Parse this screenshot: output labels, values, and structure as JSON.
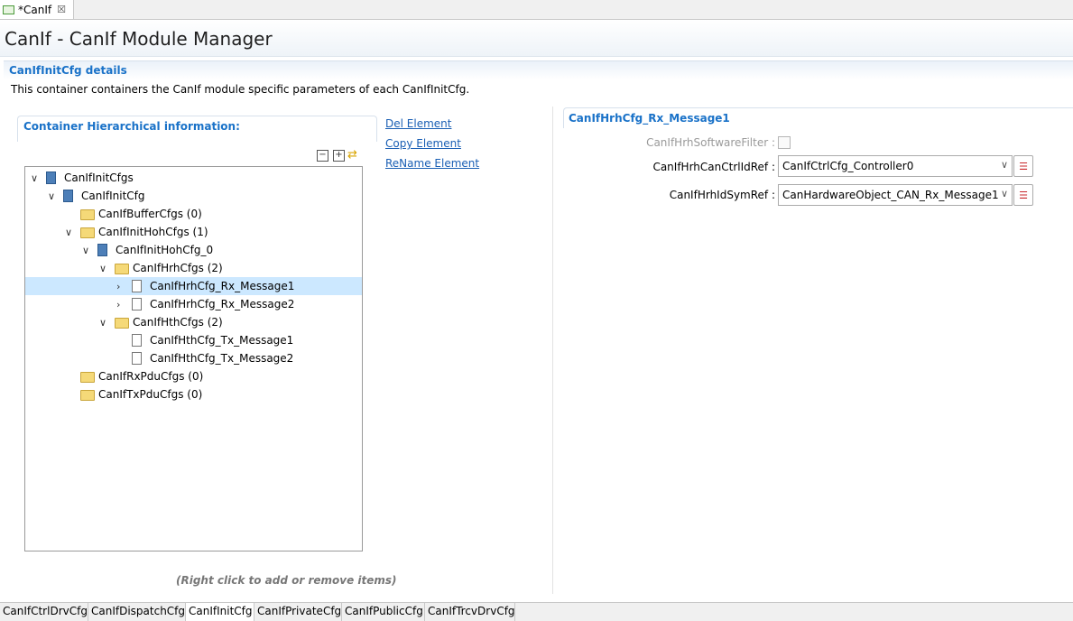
{
  "editor_tab": {
    "label": "*CanIf",
    "close": "☒"
  },
  "header": {
    "title": "CanIf - CanIf Module Manager"
  },
  "details": {
    "title": "CanIfInitCfg details",
    "description": "This container containers the CanIf module specific parameters of each CanIfInitCfg."
  },
  "hierarchy": {
    "title": "Container Hierarchical information:",
    "collapse_all": "−",
    "expand_all": "+",
    "sync": "⇄",
    "tree": [
      {
        "label": "CanIfInitCfgs",
        "icon": "module-icon",
        "expander": "∨"
      },
      {
        "label": "CanIfInitCfg",
        "icon": "module-icon",
        "expander": "∨"
      },
      {
        "label": "CanIfBufferCfgs (0)",
        "icon": "folder-icon",
        "expander": ""
      },
      {
        "label": "CanIfInitHohCfgs (1)",
        "icon": "folder-icon",
        "expander": "∨"
      },
      {
        "label": "CanIfInitHohCfg_0",
        "icon": "module-icon",
        "expander": "∨"
      },
      {
        "label": "CanIfHrhCfgs (2)",
        "icon": "folder-icon",
        "expander": "∨"
      },
      {
        "label": "CanIfHrhCfg_Rx_Message1",
        "icon": "document-icon",
        "expander": "›"
      },
      {
        "label": "CanIfHrhCfg_Rx_Message2",
        "icon": "document-icon",
        "expander": "›"
      },
      {
        "label": "CanIfHthCfgs (2)",
        "icon": "folder-icon",
        "expander": "∨"
      },
      {
        "label": "CanIfHthCfg_Tx_Message1",
        "icon": "document-icon",
        "expander": ""
      },
      {
        "label": "CanIfHthCfg_Tx_Message2",
        "icon": "document-icon",
        "expander": ""
      },
      {
        "label": "CanIfRxPduCfgs (0)",
        "icon": "folder-icon",
        "expander": ""
      },
      {
        "label": "CanIfTxPduCfgs (0)",
        "icon": "folder-icon",
        "expander": ""
      }
    ],
    "selected_index": 6,
    "hint": "(Right click to add or remove items)"
  },
  "actions": {
    "del": "Del Element",
    "copy": "Copy Element",
    "rename": "ReName Element"
  },
  "properties": {
    "title": "CanIfHrhCfg_Rx_Message1",
    "software_filter_label": "CanIfHrhSoftwareFilter :",
    "ctrl_ref_label": "CanIfHrhCanCtrlIdRef :",
    "ctrl_ref_value": "CanIfCtrlCfg_Controller0",
    "sym_ref_label": "CanIfHrhIdSymRef :",
    "sym_ref_value": "CanHardwareObject_CAN_Rx_Message1",
    "dropdown_arrow": "∨",
    "list_icon": "☰"
  },
  "bottom_tabs": [
    "CanIfCtrlDrvCfg",
    "CanIfDispatchCfg",
    "CanIfInitCfg",
    "CanIfPrivateCfg",
    "CanIfPublicCfg",
    "CanIfTrcvDrvCfg"
  ],
  "active_bottom_tab": "CanIfInitCfg"
}
